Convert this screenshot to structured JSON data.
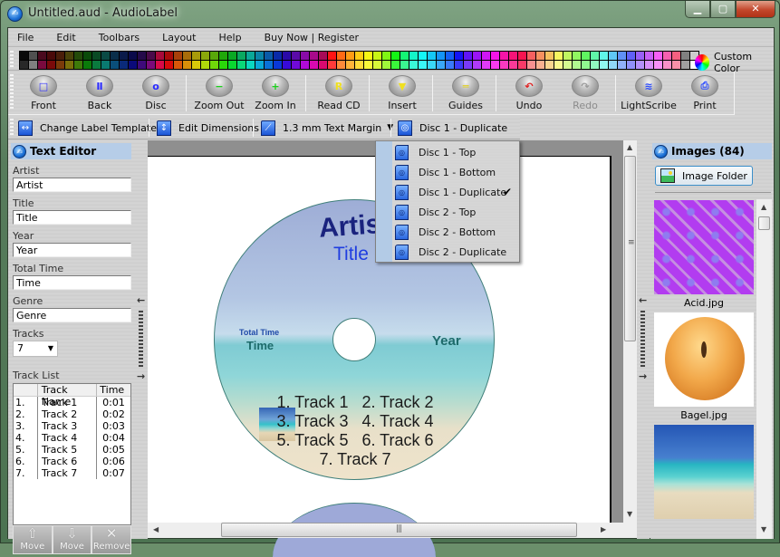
{
  "window": {
    "title": "Untitled.aud - AudioLabel",
    "controls": {
      "minimize": "▁",
      "maximize": "▢",
      "close": "✕"
    }
  },
  "menu": [
    "File",
    "Edit",
    "Toolbars",
    "Layout",
    "Help",
    "Buy Now | Register"
  ],
  "palette": {
    "custom_label": "Custom Color",
    "row1": [
      "#0a0a0a",
      "#505050",
      "#4a0a1e",
      "#4a0a0a",
      "#4a1e0a",
      "#4a420a",
      "#244a0a",
      "#0a4a0a",
      "#0a4a24",
      "#0a4a44",
      "#0a2e4a",
      "#0a1a4a",
      "#0a0a4a",
      "#240a4a",
      "#4a0a4a",
      "#a80a3a",
      "#a80a0a",
      "#a8400a",
      "#a86c0a",
      "#a89a0a",
      "#8aa80a",
      "#58a80a",
      "#20a80a",
      "#0aa824",
      "#0aa860",
      "#0aa898",
      "#0a84a8",
      "#0a5aa8",
      "#0a2aa8",
      "#2a0aa8",
      "#5a0aa8",
      "#880aa8",
      "#a80a8a",
      "#a80a58",
      "#ff1414",
      "#ff6a14",
      "#ff9c14",
      "#ffcc14",
      "#f6f614",
      "#c8f614",
      "#80f614",
      "#14f614",
      "#14f674",
      "#14f6c8",
      "#14f6f6",
      "#14c8f6",
      "#1494f6",
      "#1460f6",
      "#1414f6",
      "#6014f6",
      "#9a14f6",
      "#d014f6",
      "#f614e8",
      "#f614a8",
      "#f61478",
      "#f61450",
      "#f66060",
      "#f69060",
      "#f6c060",
      "#f6f660",
      "#c0f660",
      "#90f660",
      "#60f660",
      "#60f6a8",
      "#60f6e8",
      "#60c8f6",
      "#6090f6",
      "#6060f6",
      "#9a60f6",
      "#c860f6",
      "#f660f6",
      "#f660b0",
      "#f66080",
      "#808080",
      "#cccccc"
    ],
    "row2": [
      "#282828",
      "#808080",
      "#7a0a3e",
      "#7a0a0a",
      "#7a3a0a",
      "#7a6e0a",
      "#3e7a0a",
      "#0a7a0a",
      "#0a7a3e",
      "#0a7a70",
      "#0a4e7a",
      "#0a2a7a",
      "#0a0a7a",
      "#3e0a7a",
      "#7a0a7a",
      "#d80a48",
      "#d80a0a",
      "#d8580a",
      "#d8900a",
      "#d8c80a",
      "#b0d80a",
      "#70d80a",
      "#2ad80a",
      "#0ad830",
      "#0ad878",
      "#0ad8c0",
      "#0aa8d8",
      "#0a70d8",
      "#0a38d8",
      "#380ad8",
      "#700ad8",
      "#b00ad8",
      "#d80ab0",
      "#d80a70",
      "#ff3a3a",
      "#ff8a3a",
      "#ffb43a",
      "#ffdc3a",
      "#f8f83a",
      "#d8f83a",
      "#a0f83a",
      "#3af83a",
      "#3af890",
      "#3af8d8",
      "#3af8f8",
      "#3ad8f8",
      "#3aa8f8",
      "#3a7af8",
      "#3a3af8",
      "#7a3af8",
      "#b03af8",
      "#e03af8",
      "#f83af0",
      "#f83ac0",
      "#f83a98",
      "#f83a68",
      "#f89090",
      "#f8b090",
      "#f8d490",
      "#f8f890",
      "#d4f890",
      "#b0f890",
      "#90f890",
      "#90f8c0",
      "#90f8f0",
      "#90d8f8",
      "#90b0f8",
      "#9090f8",
      "#b490f8",
      "#d890f8",
      "#f890f8",
      "#f890c8",
      "#f890a8",
      "#a0a0a0",
      "#ffffff"
    ]
  },
  "toolbar": {
    "buttons": [
      {
        "id": "front",
        "label": "Front",
        "glyph": "□",
        "color": "#2a2aff"
      },
      {
        "id": "back",
        "label": "Back",
        "glyph": "Ⅱ",
        "color": "#2a2aff"
      },
      {
        "id": "disc",
        "label": "Disc",
        "glyph": "o",
        "color": "#2a2aff"
      },
      {
        "id": "zoom-out",
        "label": "Zoom Out",
        "glyph": "−",
        "color": "#1ad01a"
      },
      {
        "id": "zoom-in",
        "label": "Zoom In",
        "glyph": "+",
        "color": "#1ad01a"
      },
      {
        "id": "read-cd",
        "label": "Read CD",
        "glyph": "R",
        "color": "#f0e020"
      },
      {
        "id": "insert",
        "label": "Insert",
        "glyph": "▼",
        "color": "#f0e020"
      },
      {
        "id": "guides",
        "label": "Guides",
        "glyph": "═",
        "color": "#e0d020"
      },
      {
        "id": "undo",
        "label": "Undo",
        "glyph": "↶",
        "color": "#e02020"
      },
      {
        "id": "redo",
        "label": "Redo",
        "glyph": "↷",
        "color": "#9a9a9a",
        "disabled": true
      },
      {
        "id": "lightscribe",
        "label": "LightScribe",
        "glyph": "≋",
        "color": "#2a4aff"
      },
      {
        "id": "print",
        "label": "Print",
        "glyph": "⎙",
        "color": "#2a4aff"
      }
    ]
  },
  "toolbar2": {
    "change_template": "Change Label Template",
    "edit_dimensions": "Edit Dimensions",
    "text_margin": "1.3 mm Text Margin",
    "disc_select": "Disc 1 - Duplicate"
  },
  "disc_menu": {
    "items": [
      {
        "label": "Disc 1 - Top",
        "checked": false
      },
      {
        "label": "Disc 1 - Bottom",
        "checked": false
      },
      {
        "label": "Disc 1 - Duplicate",
        "checked": true
      },
      {
        "label": "Disc 2 - Top",
        "checked": false
      },
      {
        "label": "Disc 2 - Bottom",
        "checked": false
      },
      {
        "label": "Disc 2 - Duplicate",
        "checked": false
      }
    ],
    "check_glyph": "✔"
  },
  "text_editor": {
    "header": "Text Editor",
    "artist_label": "Artist",
    "artist_value": "Artist",
    "title_label": "Title",
    "title_value": "Title",
    "year_label": "Year",
    "year_value": "Year",
    "total_time_label": "Total Time",
    "total_time_value": "Time",
    "genre_label": "Genre",
    "genre_value": "Genre",
    "tracks_label": "Tracks",
    "tracks_value": "7",
    "track_list_label": "Track List",
    "columns": [
      "",
      "Track Name",
      "Time"
    ],
    "tracks": [
      {
        "num": "1.",
        "name": "Track 1",
        "time": "0:01"
      },
      {
        "num": "2.",
        "name": "Track 2",
        "time": "0:02"
      },
      {
        "num": "3.",
        "name": "Track 3",
        "time": "0:03"
      },
      {
        "num": "4.",
        "name": "Track 4",
        "time": "0:04"
      },
      {
        "num": "5.",
        "name": "Track 5",
        "time": "0:05"
      },
      {
        "num": "6.",
        "name": "Track 6",
        "time": "0:06"
      },
      {
        "num": "7.",
        "name": "Track 7",
        "time": "0:07"
      }
    ],
    "move_up": "Move",
    "move_down": "Move",
    "remove": "Remove"
  },
  "label": {
    "artist": "Artist",
    "title": "Title",
    "total_time_caption": "Total Time",
    "time": "Time",
    "year": "Year",
    "track_lines": [
      "1. Track 1   2. Track 2",
      "3. Track 3   4. Track 4",
      "5. Track 5   6. Track 6",
      "7. Track 7"
    ],
    "colors": {
      "artist": "#1a237e",
      "title": "#1f3de0",
      "caption": "#1f4aa8",
      "time": "#1d6b6b"
    }
  },
  "images_panel": {
    "header": "Images (84)",
    "folder_button": "Image Folder",
    "items": [
      {
        "name": "Acid.jpg",
        "kind": "acid"
      },
      {
        "name": "Bagel.jpg",
        "kind": "bagel"
      },
      {
        "name": "",
        "kind": "beach"
      }
    ]
  }
}
